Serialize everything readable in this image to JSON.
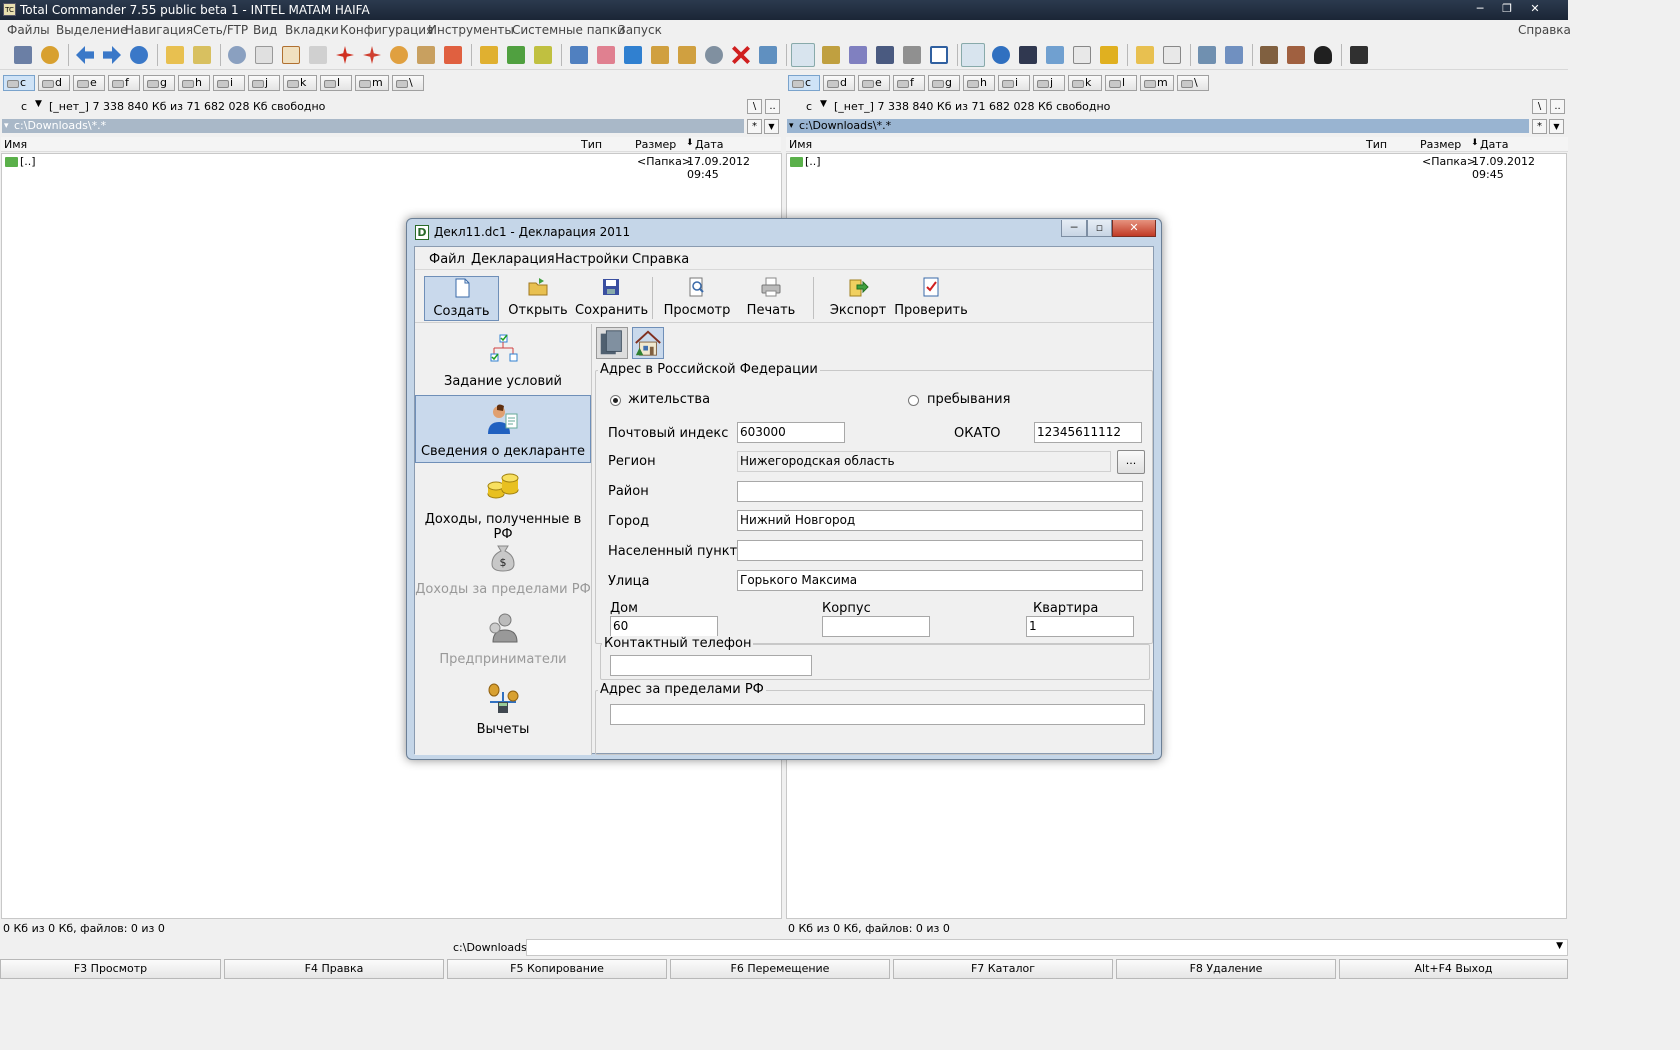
{
  "window": {
    "title": "Total Commander 7.55 public beta 1 - INTEL MATAM HAIFA",
    "app_icon": "tc-icon"
  },
  "menu": [
    "Файлы",
    "Выделение",
    "Навигация",
    "Сеть/FTP",
    "Вид",
    "Вкладки",
    "Конфигурация",
    "Инструменты",
    "Системные папки",
    "Запуск"
  ],
  "menu_help": "Справка",
  "drives": [
    "c",
    "d",
    "e",
    "f",
    "g",
    "h",
    "i",
    "j",
    "k",
    "l",
    "m",
    "\\"
  ],
  "left_panel": {
    "drive_combo": "c",
    "info": "[_нет_]  7 338 840 Кб из 71 682 028 Кб свободно",
    "path": "c:\\Downloads\\*.*",
    "columns": {
      "name": "Имя",
      "type": "Тип",
      "size": "Размер",
      "date": "Дата"
    },
    "row": {
      "name": "[..]",
      "size": "<Папка>",
      "date": "17.09.2012 09:45"
    },
    "status": "0 Кб из 0 Кб, файлов: 0 из 0"
  },
  "right_panel": {
    "drive_combo": "c",
    "info": "[_нет_]  7 338 840 Кб из 71 682 028 Кб свободно",
    "path": "c:\\Downloads\\*.*",
    "columns": {
      "name": "Имя",
      "type": "Тип",
      "size": "Размер",
      "date": "Дата"
    },
    "row": {
      "name": "[..]",
      "size": "<Папка>",
      "date": "17.09.2012 09:45"
    },
    "status": "0 Кб из 0 Кб, файлов: 0 из 0"
  },
  "panel_buttons": {
    "root": "\\",
    "up": "..",
    "star": "*",
    "down": "▼"
  },
  "cmdline": {
    "label": "c:\\Downloads>"
  },
  "fkeys": [
    "F3 Просмотр",
    "F4 Правка",
    "F5 Копирование",
    "F6 Перемещение",
    "F7 Каталог",
    "F8 Удаление",
    "Alt+F4 Выход"
  ],
  "dialog": {
    "title": "Декл11.dc1 - Декларация 2011",
    "icon_letter": "D",
    "menu": [
      "Файл",
      "Декларация",
      "Настройки",
      "Справка"
    ],
    "toolbar": [
      "Создать",
      "Открыть",
      "Сохранить",
      "Просмотр",
      "Печать",
      "Экспорт",
      "Проверить"
    ],
    "nav": [
      "Задание условий",
      "Сведения о декларанте",
      "Доходы, полученные в РФ",
      "Доходы за пределами РФ",
      "Предприниматели",
      "Вычеты"
    ],
    "address_group": "Адрес в Российской Федерации",
    "radio_residence": "жительства",
    "radio_stay": "пребывания",
    "labels": {
      "postal": "Почтовый индекс",
      "okato": "ОКАТО",
      "region": "Регион",
      "district": "Район",
      "city": "Город",
      "locality": "Населенный пункт",
      "street": "Улица",
      "house": "Дом",
      "building": "Корпус",
      "apartment": "Квартира"
    },
    "values": {
      "postal": "603000",
      "okato": "12345611112",
      "region": "Нижегородская область",
      "district": "",
      "city": "Нижний Новгород",
      "locality": "",
      "street": "Горького Максима",
      "house": "60",
      "building": "",
      "apartment": "1",
      "phone": "",
      "foreign": ""
    },
    "region_button": "...",
    "phone_group": "Контактный телефон",
    "foreign_group": "Адрес за пределами РФ"
  }
}
